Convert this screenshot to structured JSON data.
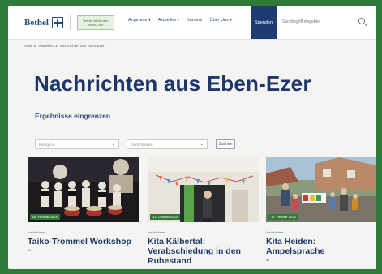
{
  "header": {
    "logo_text": "Bethel",
    "logo_sub": "Bethel im Norden\nEben-Ezer",
    "nav": [
      "Angebote",
      "Aktuelles",
      "Karriere",
      "Über Uns"
    ],
    "donate_label": "Spenden",
    "search_placeholder": "Suchbegriff eingeben"
  },
  "breadcrumb": [
    "Start",
    "Aktuelles",
    "Nachrichten aus Eben-Ezer"
  ],
  "page_title": "Nachrichten aus Eben-Ezer",
  "filter": {
    "heading": "Ergebnisse eingrenzen",
    "select_1": "Kategorie",
    "select_2": "Einrichtungen",
    "button_label": "Suchen"
  },
  "cards": [
    {
      "date": "08. Februar 2024",
      "category": "Nachrichten",
      "title": "Taiko-Trommel Workshop",
      "meta": "all"
    },
    {
      "date": "31. Oktober 2023",
      "category": "Nachrichten",
      "title": "Kita Kälbertal: Verabschiedung in den Ruhestand",
      "meta": ""
    },
    {
      "date": "17. Februar 2023",
      "category": "Nachrichten",
      "title": "Kita Heiden: Ampelsprache",
      "meta": "all"
    }
  ],
  "colors": {
    "brand_blue": "#1f3768",
    "brand_green": "#2f7a38",
    "background": "#2f7a38"
  }
}
